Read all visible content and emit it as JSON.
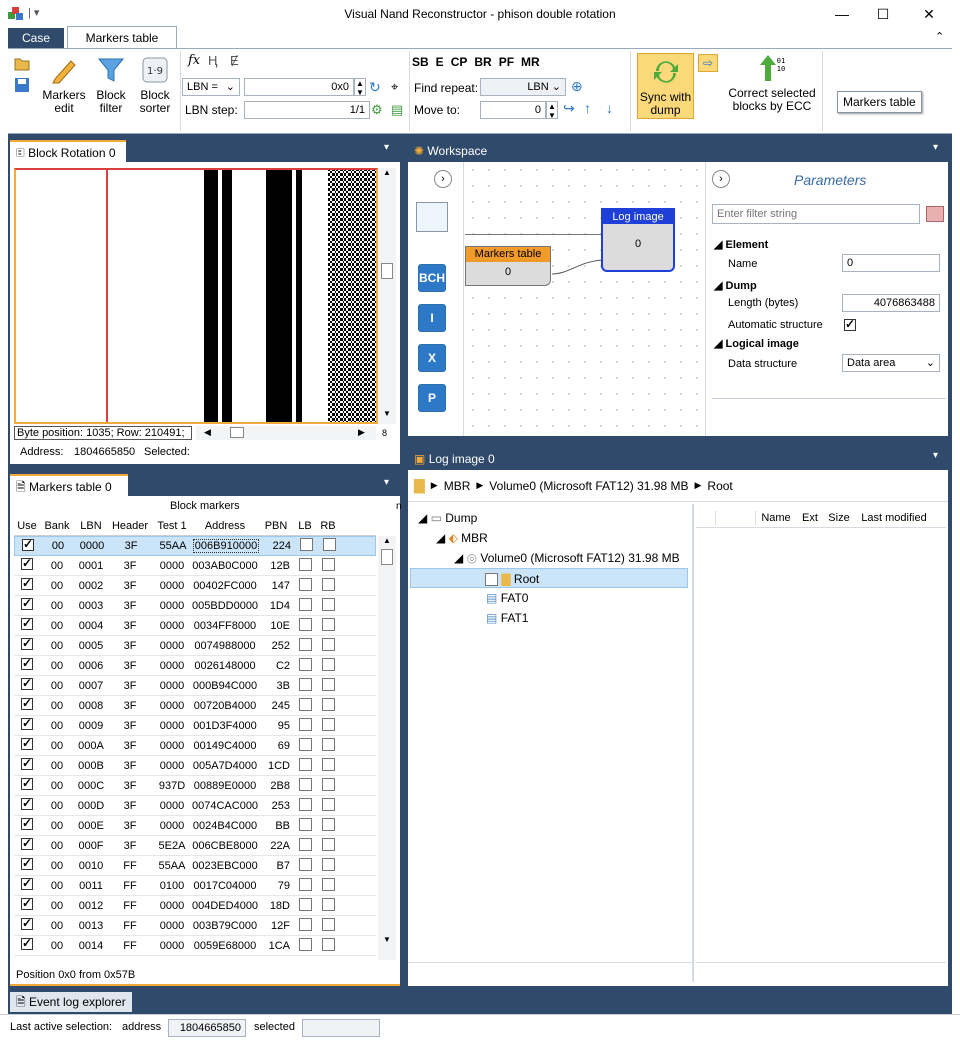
{
  "window": {
    "title": "Visual Nand Reconstructor - phison double rotation",
    "menu_icons": "app-icons"
  },
  "tabs": {
    "case": "Case",
    "markers_table": "Markers table"
  },
  "ribbon": {
    "markers_edit": "Markers\nedit",
    "block_filter": "Block\nfilter",
    "block_sorter": "Block\nsorter",
    "lbn_select": "LBN =",
    "lbn_value": "0x0",
    "lbn_step_label": "LBN step:",
    "lbn_step_value": "1/1",
    "toggles": [
      "SB",
      "E",
      "CP",
      "BR",
      "PF",
      "MR"
    ],
    "find_repeat_label": "Find repeat:",
    "find_repeat_value": "LBN",
    "move_to_label": "Move to:",
    "move_to_value": "0",
    "sync_with_dump": "Sync with\ndump",
    "correct_ecc": "Correct selected\nblocks by ECC",
    "tooltip": "Markers table"
  },
  "block_rotation": {
    "title": "Block Rotation 0",
    "status": "Byte position: 1035; Row: 210491;",
    "scroll_num": "8",
    "address_label": "Address:",
    "address_value": "1804665850",
    "selected_label": "Selected:"
  },
  "workspace": {
    "title": "Workspace",
    "log_image_node": "Log image",
    "log_image_value": "0",
    "markers_node": "Markers table",
    "markers_value": "0",
    "tool_buttons": [
      "BCH",
      "I",
      "X",
      "P"
    ],
    "parameters_title": "Parameters",
    "filter_placeholder": "Enter filter string",
    "element_section": "Element",
    "name_label": "Name",
    "name_value": "0",
    "dump_section": "Dump",
    "length_label": "Length (bytes)",
    "length_value": "4076863488",
    "auto_struct_label": "Automatic structure",
    "logical_section": "Logical image",
    "data_struct_label": "Data structure",
    "data_struct_value": "Data area"
  },
  "markers": {
    "title": "Markers table 0",
    "group_header": "Block markers",
    "n_col": "n",
    "columns": [
      "Use",
      "Bank",
      "LBN",
      "Header",
      "Test 1",
      "Address",
      "PBN",
      "LB",
      "RB"
    ],
    "rows": [
      [
        "00",
        "0000",
        "3F",
        "55AA",
        "006B910000",
        "224"
      ],
      [
        "00",
        "0001",
        "3F",
        "0000",
        "003AB0C000",
        "12B"
      ],
      [
        "00",
        "0002",
        "3F",
        "0000",
        "00402FC000",
        "147"
      ],
      [
        "00",
        "0003",
        "3F",
        "0000",
        "005BDD0000",
        "1D4"
      ],
      [
        "00",
        "0004",
        "3F",
        "0000",
        "0034FF8000",
        "10E"
      ],
      [
        "00",
        "0005",
        "3F",
        "0000",
        "0074988000",
        "252"
      ],
      [
        "00",
        "0006",
        "3F",
        "0000",
        "0026148000",
        "C2"
      ],
      [
        "00",
        "0007",
        "3F",
        "0000",
        "000B94C000",
        "3B"
      ],
      [
        "00",
        "0008",
        "3F",
        "0000",
        "00720B4000",
        "245"
      ],
      [
        "00",
        "0009",
        "3F",
        "0000",
        "001D3F4000",
        "95"
      ],
      [
        "00",
        "000A",
        "3F",
        "0000",
        "00149C4000",
        "69"
      ],
      [
        "00",
        "000B",
        "3F",
        "0000",
        "005A7D4000",
        "1CD"
      ],
      [
        "00",
        "000C",
        "3F",
        "937D",
        "00889E0000",
        "2B8"
      ],
      [
        "00",
        "000D",
        "3F",
        "0000",
        "0074CAC000",
        "253"
      ],
      [
        "00",
        "000E",
        "3F",
        "0000",
        "0024B4C000",
        "BB"
      ],
      [
        "00",
        "000F",
        "3F",
        "5E2A",
        "006CBE8000",
        "22A"
      ],
      [
        "00",
        "0010",
        "FF",
        "55AA",
        "0023EBC000",
        "B7"
      ],
      [
        "00",
        "0011",
        "FF",
        "0100",
        "0017C04000",
        "79"
      ],
      [
        "00",
        "0012",
        "FF",
        "0000",
        "004DED4000",
        "18D"
      ],
      [
        "00",
        "0013",
        "FF",
        "0000",
        "003B79C000",
        "12F"
      ],
      [
        "00",
        "0014",
        "FF",
        "0000",
        "0059E68000",
        "1CA"
      ]
    ],
    "position": "Position 0x0 from 0x57B"
  },
  "log_image": {
    "title": "Log image 0",
    "breadcrumb": [
      "MBR",
      "Volume0 (Microsoft FAT12)  31.98 MB",
      "Root"
    ],
    "tree": {
      "dump": "Dump",
      "mbr": "MBR",
      "volume": "Volume0 (Microsoft FAT12)   31.98 MB",
      "root": "Root",
      "fat0": "FAT0",
      "fat1": "FAT1"
    },
    "file_columns": [
      "Name",
      "Ext",
      "Size",
      "Last modified"
    ]
  },
  "event_log": "Event log explorer",
  "status": {
    "label": "Last active selection:",
    "address_label": "address",
    "address_value": "1804665850",
    "selected_label": "selected",
    "selected_value": ""
  }
}
